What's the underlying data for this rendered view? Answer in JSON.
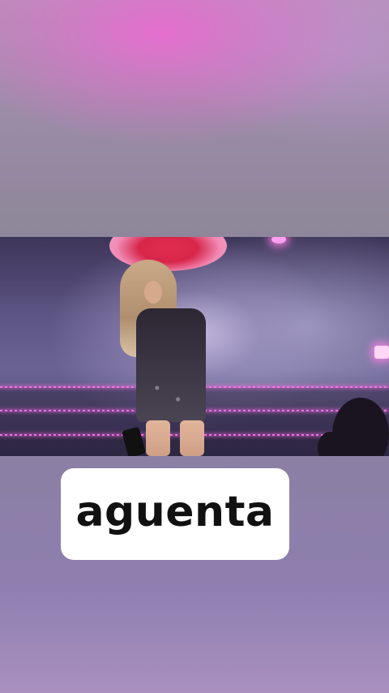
{
  "caption": {
    "text": "aguenta"
  },
  "colors": {
    "caption_background": "#ffffff",
    "caption_text": "#111111",
    "stage_light": "#ff6ee8"
  }
}
